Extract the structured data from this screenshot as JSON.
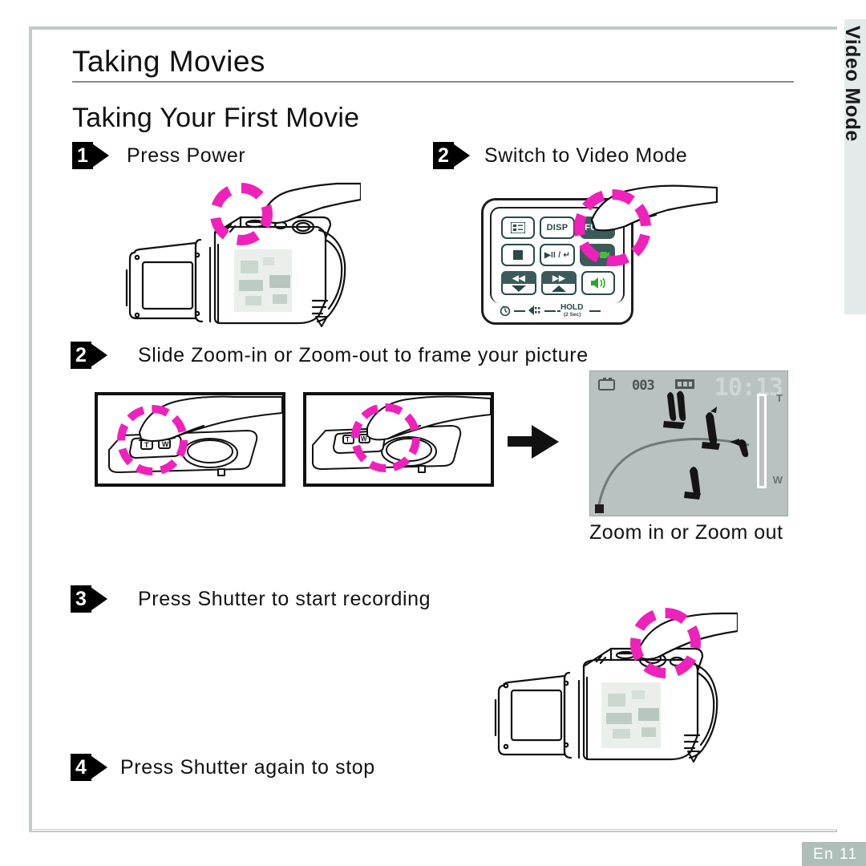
{
  "page": {
    "heading": "Taking Movies",
    "subheading": "Taking Your First Movie",
    "side_tab_label": "Video Mode",
    "footer_label": "En 11",
    "border_color": "#bfccc9",
    "accent_magenta": "#ee22bb",
    "footer_bar_color": "#aebfba",
    "side_tab_color": "#e4eaea"
  },
  "steps": [
    {
      "number": "1",
      "text": "Press Power"
    },
    {
      "number": "2",
      "text": "Switch to Video Mode"
    },
    {
      "number": "2",
      "text": "Slide Zoom-in or Zoom-out to frame your picture"
    },
    {
      "number": "3",
      "text": "Press Shutter to start recording"
    },
    {
      "number": "4",
      "text": "Press Shutter again to stop"
    }
  ],
  "control_panel": {
    "buttons": [
      {
        "name": "menu-button",
        "label": ""
      },
      {
        "name": "disp-button",
        "label": "DISP"
      },
      {
        "name": "func-button",
        "label": "FUNC"
      },
      {
        "name": "stop-button",
        "label": ""
      },
      {
        "name": "play-pause-button",
        "label": "▶II / ↵"
      },
      {
        "name": "record-mode-button",
        "label": ""
      },
      {
        "name": "rewind-button",
        "label": "◀◀"
      },
      {
        "name": "forward-button",
        "label": "▶▶"
      },
      {
        "name": "speaker-button",
        "label": ""
      }
    ],
    "bottom_labels": {
      "timer": "⏱",
      "flash": "",
      "hold": "HOLD",
      "hold_sub": "(2 Sec)"
    }
  },
  "lcd": {
    "time": "10:13",
    "counter": "003",
    "zoom_tele": "T",
    "zoom_wide": "W",
    "caption": "Zoom in or Zoom out"
  }
}
